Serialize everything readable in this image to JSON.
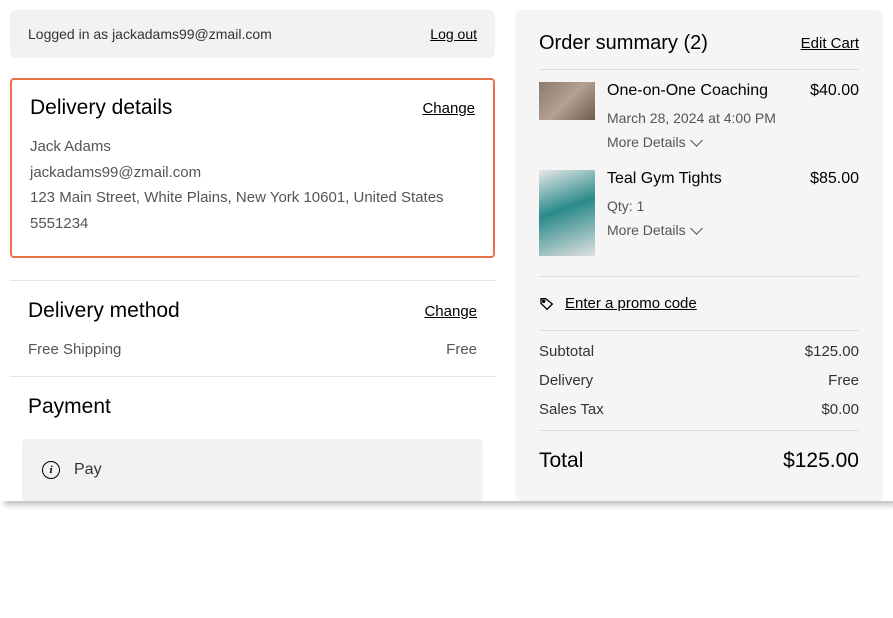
{
  "login": {
    "text": "Logged in as jackadams99@zmail.com",
    "logout": "Log out"
  },
  "delivery_details": {
    "title": "Delivery details",
    "change": "Change",
    "name": "Jack Adams",
    "email": "jackadams99@zmail.com",
    "address": "123 Main Street, White Plains, New York  10601, United States",
    "phone": "5551234"
  },
  "delivery_method": {
    "title": "Delivery method",
    "change": "Change",
    "name": "Free Shipping",
    "price": "Free"
  },
  "payment": {
    "title": "Payment",
    "pay_label": "Pay"
  },
  "summary": {
    "title": "Order summary (2)",
    "edit": "Edit Cart",
    "items": [
      {
        "name": "One-on-One Coaching",
        "price": "$40.00",
        "meta": "March 28, 2024 at 4:00 PM",
        "more": "More Details"
      },
      {
        "name": "Teal Gym Tights",
        "price": "$85.00",
        "meta": "Qty: 1",
        "more": "More Details"
      }
    ],
    "promo": "Enter a promo code",
    "subtotal_label": "Subtotal",
    "subtotal_value": "$125.00",
    "delivery_label": "Delivery",
    "delivery_value": "Free",
    "tax_label": "Sales Tax",
    "tax_value": "$0.00",
    "total_label": "Total",
    "total_value": "$125.00"
  }
}
